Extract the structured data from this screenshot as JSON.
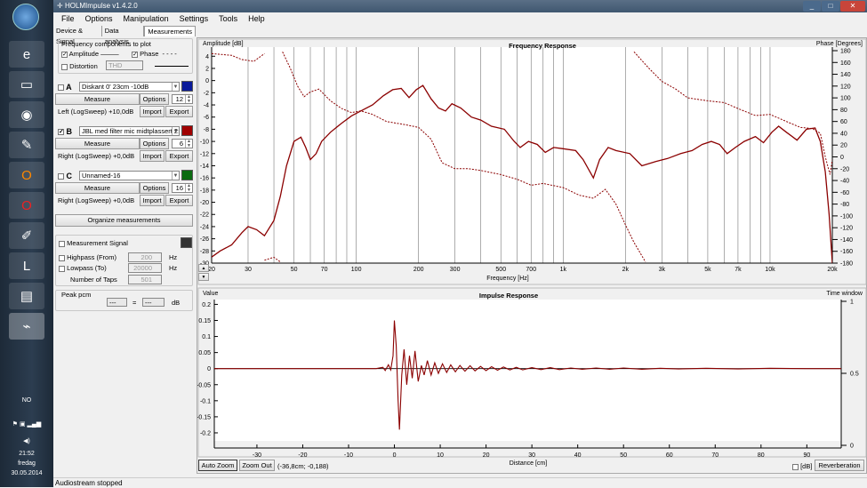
{
  "window": {
    "title": "HOLMImpulse  v1.4.2.0",
    "controls": [
      "_",
      "□",
      "✕"
    ]
  },
  "menu": [
    "File",
    "Options",
    "Manipulation",
    "Settings",
    "Tools",
    "Help"
  ],
  "tabs": [
    "Device & Signal",
    "Data analysis",
    "Measurements"
  ],
  "freq_components": {
    "title": "Frequency components to plot",
    "amplitude": "Amplitude",
    "phase": "Phase",
    "distortion": "Distortion",
    "distortion_select": "THD"
  },
  "measurements": [
    {
      "letter": "A",
      "checked": false,
      "name": "Diskant 0' 23cm -10dB",
      "color": "#0a1a9a",
      "measure": "Measure",
      "options": "Options",
      "spin": "12",
      "info": "Left (LogSweep) +10,0dB",
      "import": "Import",
      "export": "Export"
    },
    {
      "letter": "B",
      "checked": true,
      "name": "JBL med filter mic midtplassert 2:",
      "color": "#a00000",
      "measure": "Measure",
      "options": "Options",
      "spin": "6",
      "info": "Right (LogSweep) +0,0dB",
      "import": "Import",
      "export": "Export"
    },
    {
      "letter": "C",
      "checked": false,
      "name": "Unnamed-16",
      "color": "#0a6a10",
      "measure": "Measure",
      "options": "Options",
      "spin": "16",
      "info": "Right (LogSweep) +0,0dB",
      "import": "Import",
      "export": "Export"
    }
  ],
  "organize": "Organize measurements",
  "signal": {
    "title": "Measurement Signal",
    "highpass": "Highpass (From)",
    "highpass_val": "200",
    "lowpass": "Lowpass (To)",
    "lowpass_val": "20000",
    "hz": "Hz",
    "taps": "Number of Taps",
    "taps_val": "501"
  },
  "peak": {
    "title": "Peak pcm",
    "a": "---",
    "sep": "=",
    "b": "---",
    "unit": "dB"
  },
  "buttons": {
    "auto_zoom": "Auto Zoom",
    "zoom_out": "Zoom Out",
    "coords": "(-36,8cm; -0,188)",
    "db": "[dB]",
    "reverberation": "Reverberation"
  },
  "status": "Audiostream stopped",
  "tray": {
    "lang": "NO",
    "time": "21:52",
    "day": "fredag",
    "date": "30.05.2014"
  },
  "chart_data": [
    {
      "type": "line",
      "title": "Frequency Response",
      "xlabel": "Frequency [Hz]",
      "ylabel": "Amplitude [dB]",
      "y2label": "Phase [Degrees]",
      "xscale": "log",
      "xlim": [
        20,
        20000
      ],
      "ylim": [
        -30,
        5.5
      ],
      "y2lim": [
        -180,
        180
      ],
      "xticks": [
        20,
        30,
        50,
        70,
        100,
        200,
        300,
        500,
        700,
        1000,
        2000,
        3000,
        5000,
        7000,
        10000,
        20000
      ],
      "xticklabels": [
        "20",
        "30",
        "50",
        "70",
        "100",
        "200",
        "300",
        "500",
        "700",
        "1k",
        "2k",
        "3k",
        "5k",
        "7k",
        "10k",
        "20k"
      ],
      "yticks": [
        4,
        2,
        0,
        -2,
        -4,
        -6,
        -8,
        -10,
        -12,
        -14,
        -16,
        -18,
        -20,
        -22,
        -24,
        -26,
        -28,
        -30
      ],
      "y2ticks": [
        180,
        160,
        140,
        120,
        100,
        80,
        60,
        40,
        20,
        0,
        -20,
        -40,
        -60,
        -80,
        -100,
        -120,
        -140,
        -160,
        -180
      ],
      "series": [
        {
          "name": "Amplitude",
          "color": "#8b0000",
          "dash": false,
          "axis": "y",
          "points": [
            [
              20,
              -29
            ],
            [
              22,
              -28
            ],
            [
              25,
              -27
            ],
            [
              28,
              -25
            ],
            [
              30,
              -24
            ],
            [
              33,
              -24.5
            ],
            [
              36,
              -25.5
            ],
            [
              40,
              -23
            ],
            [
              43,
              -19
            ],
            [
              46,
              -14
            ],
            [
              50,
              -10
            ],
            [
              54,
              -9.3
            ],
            [
              57,
              -11
            ],
            [
              60,
              -13
            ],
            [
              64,
              -12
            ],
            [
              68,
              -10
            ],
            [
              75,
              -8.5
            ],
            [
              85,
              -7
            ],
            [
              95,
              -5.8
            ],
            [
              105,
              -5
            ],
            [
              120,
              -4
            ],
            [
              135,
              -2.5
            ],
            [
              150,
              -1.5
            ],
            [
              165,
              -1.3
            ],
            [
              180,
              -2.8
            ],
            [
              195,
              -1.5
            ],
            [
              210,
              -0.8
            ],
            [
              230,
              -3
            ],
            [
              250,
              -4.5
            ],
            [
              270,
              -5
            ],
            [
              290,
              -3.8
            ],
            [
              320,
              -4.5
            ],
            [
              360,
              -6
            ],
            [
              400,
              -6.5
            ],
            [
              450,
              -7.5
            ],
            [
              520,
              -8
            ],
            [
              580,
              -10
            ],
            [
              620,
              -11
            ],
            [
              680,
              -10
            ],
            [
              750,
              -10.5
            ],
            [
              820,
              -11.8
            ],
            [
              900,
              -11
            ],
            [
              1000,
              -11.2
            ],
            [
              1150,
              -11.5
            ],
            [
              1250,
              -13
            ],
            [
              1400,
              -16
            ],
            [
              1500,
              -13
            ],
            [
              1650,
              -11
            ],
            [
              1800,
              -11.5
            ],
            [
              2100,
              -12
            ],
            [
              2400,
              -14
            ],
            [
              2800,
              -13.3
            ],
            [
              3200,
              -12.8
            ],
            [
              3700,
              -12
            ],
            [
              4200,
              -11.5
            ],
            [
              4700,
              -10.5
            ],
            [
              5200,
              -10
            ],
            [
              5700,
              -10.5
            ],
            [
              6200,
              -12
            ],
            [
              6800,
              -11
            ],
            [
              7500,
              -10
            ],
            [
              8500,
              -9.2
            ],
            [
              9300,
              -10.2
            ],
            [
              10200,
              -8.5
            ],
            [
              11000,
              -7.5
            ],
            [
              12000,
              -8.5
            ],
            [
              13500,
              -9.8
            ],
            [
              15000,
              -8
            ],
            [
              16500,
              -7.8
            ],
            [
              17500,
              -10
            ],
            [
              18500,
              -15
            ],
            [
              19300,
              -22
            ],
            [
              20000,
              -30
            ]
          ]
        },
        {
          "name": "Phase",
          "color": "#8b0000",
          "dash": true,
          "axis": "y2",
          "points": [
            [
              20,
              175
            ],
            [
              25,
              172
            ],
            [
              28,
              165
            ],
            [
              32,
              162
            ],
            [
              36,
              175
            ],
            null,
            [
              36,
              -175
            ],
            [
              40,
              -170
            ],
            [
              43,
              -178
            ],
            null,
            [
              44,
              178
            ],
            [
              48,
              150
            ],
            [
              52,
              120
            ],
            [
              56,
              102
            ],
            [
              60,
              110
            ],
            [
              66,
              115
            ],
            [
              75,
              95
            ],
            [
              85,
              82
            ],
            [
              95,
              75
            ],
            [
              105,
              78
            ],
            [
              120,
              72
            ],
            [
              140,
              60
            ],
            [
              170,
              55
            ],
            [
              200,
              50
            ],
            [
              230,
              30
            ],
            [
              260,
              -10
            ],
            [
              300,
              -20
            ],
            [
              350,
              -20
            ],
            [
              400,
              -23
            ],
            [
              500,
              -30
            ],
            [
              600,
              -38
            ],
            [
              700,
              -48
            ],
            [
              800,
              -45
            ],
            [
              1000,
              -52
            ],
            [
              1200,
              -65
            ],
            [
              1400,
              -70
            ],
            [
              1600,
              -55
            ],
            [
              1800,
              -80
            ],
            [
              2000,
              -115
            ],
            [
              2200,
              -145
            ],
            [
              2500,
              -178
            ],
            null,
            [
              2200,
              178
            ],
            [
              2600,
              150
            ],
            [
              3000,
              128
            ],
            [
              3500,
              115
            ],
            [
              4000,
              100
            ],
            [
              5000,
              95
            ],
            [
              6000,
              92
            ],
            [
              7000,
              82
            ],
            [
              8500,
              70
            ],
            [
              10000,
              72
            ],
            [
              12000,
              60
            ],
            [
              14000,
              50
            ],
            [
              16000,
              48
            ],
            [
              17500,
              40
            ],
            [
              18500,
              0
            ],
            [
              19500,
              -30
            ],
            [
              20000,
              -5
            ]
          ]
        }
      ]
    },
    {
      "type": "line",
      "title": "Impulse Response",
      "xlabel": "Distance [cm]",
      "ylabel": "Value",
      "y2label": "Time window",
      "xlim": [
        -39.3,
        97.5
      ],
      "ylim": [
        -0.225,
        0.215
      ],
      "y2lim": [
        0,
        1
      ],
      "xticks": [
        -30,
        -20,
        -10,
        0,
        10,
        20,
        30,
        40,
        50,
        60,
        70,
        80,
        90
      ],
      "yticks": [
        0.2,
        0.15,
        0.1,
        0.05,
        0,
        -0.05,
        -0.1,
        -0.15,
        -0.2
      ],
      "yticklabels": [
        "0.2",
        "0.15",
        "0.1",
        "0.05",
        "0",
        "-0.05",
        "-0.1",
        "-0.15",
        "-0.2"
      ],
      "y2ticks": [
        1,
        0.5,
        0
      ],
      "y2ticklabels": [
        "1",
        "0.5",
        "0"
      ],
      "series": [
        {
          "name": "Impulse",
          "color": "#8b0000",
          "points": [
            [
              -39.3,
              0
            ],
            [
              -4,
              0
            ],
            [
              -2.5,
              0.004
            ],
            [
              -2,
              -0.006
            ],
            [
              -1.3,
              0.012
            ],
            [
              -0.8,
              -0.004
            ],
            [
              -0.3,
              0.04
            ],
            [
              0,
              0.15
            ],
            [
              0.4,
              0.07
            ],
            [
              0.8,
              -0.1
            ],
            [
              1.1,
              -0.19
            ],
            [
              1.6,
              -0.02
            ],
            [
              2.1,
              0.06
            ],
            [
              2.7,
              -0.05
            ],
            [
              3.3,
              0.04
            ],
            [
              3.9,
              -0.03
            ],
            [
              4.5,
              0.055
            ],
            [
              5.2,
              -0.04
            ],
            [
              5.9,
              0.01
            ],
            [
              6.5,
              -0.02
            ],
            [
              7.2,
              0.025
            ],
            [
              8,
              -0.02
            ],
            [
              8.8,
              0.018
            ],
            [
              9.6,
              -0.015
            ],
            [
              10.5,
              0.015
            ],
            [
              11.4,
              -0.012
            ],
            [
              12.3,
              0.012
            ],
            [
              13.3,
              -0.01
            ],
            [
              14.3,
              0.01
            ],
            [
              15.4,
              -0.008
            ],
            [
              16.5,
              0.009
            ],
            [
              17.6,
              -0.007
            ],
            [
              18.8,
              0.007
            ],
            [
              20,
              -0.006
            ],
            [
              21.2,
              0.006
            ],
            [
              22.5,
              -0.005
            ],
            [
              23.8,
              0.005
            ],
            [
              25.2,
              -0.004
            ],
            [
              26.6,
              0.004
            ],
            [
              28,
              -0.004
            ],
            [
              30,
              0.003
            ],
            [
              32,
              -0.003
            ],
            [
              34,
              0.003
            ],
            [
              36,
              -0.003
            ],
            [
              38.5,
              0.002
            ],
            [
              41,
              -0.002
            ],
            [
              44,
              0.002
            ],
            [
              47,
              -0.002
            ],
            [
              50,
              0.002
            ],
            [
              54,
              -0.002
            ],
            [
              58,
              0.001
            ],
            [
              62,
              -0.001
            ],
            [
              68,
              0.001
            ],
            [
              75,
              -0.001
            ],
            [
              82,
              0.001
            ],
            [
              90,
              0
            ],
            [
              97.5,
              0
            ]
          ]
        },
        {
          "name": "Time window",
          "color": "#000000",
          "axis": "y2",
          "points": [
            [
              -39.3,
              0
            ],
            [
              96.5,
              0
            ],
            [
              96.5,
              1
            ]
          ]
        }
      ]
    }
  ]
}
